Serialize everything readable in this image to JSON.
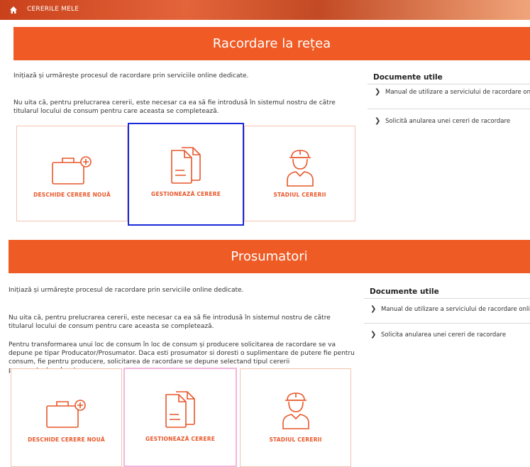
{
  "nav": {
    "breadcrumb": "CERERILE MELE"
  },
  "section1": {
    "title": "Racordare la rețea",
    "intro": "Inițiază și urmărește procesul de racordare prin serviciile online dedicate.",
    "note": "Nu uita că, pentru prelucrarea cererii, este necesar ca ea să fie introdusă în sistemul nostru de către titularul locului de consum pentru care aceasta se completează.",
    "docs_title": "Documente utile",
    "docs": [
      "Manual de utilizare a serviciului de racordare online",
      "Solicită anularea unei cereri de racordare"
    ],
    "cards": [
      "DESCHIDE CERERE NOUĂ",
      "GESTIONEAZĂ CERERE",
      "STADIUL CERERII"
    ]
  },
  "section2": {
    "title": "Prosumatori",
    "intro": "Inițiază și urmărește procesul de racordare prin serviciile online dedicate.",
    "note": "Nu uita că, pentru prelucrarea cererii, este necesar ca ea să fie introdusă în sistemul nostru de către titularul locului de consum pentru care aceasta se completează.",
    "extra": "Pentru transformarea unui loc de consum în loc de consum și producere solicitarea de racordare se va depune pe tipar Producator/Prosumator. Daca esti prosumator si doresti o suplimentare de putere fie pentru consum, fie pentru producere, solicitarea de racordare se depune selectand tipul cererii prosumator/producator.",
    "docs_title": "Documente utile",
    "docs": [
      "Manual de utilizare a serviciului de racordare online",
      "Solicita anularea unei cereri de racordare"
    ],
    "cards": [
      "DESCHIDE CERERE NOUĂ",
      "GESTIONEAZĂ CERERE",
      "STADIUL CERERII"
    ]
  },
  "colors": {
    "accent": "#f05a24",
    "icon": "#e8572a",
    "card_border": "#f3c3b1",
    "selected_blue": "#1a2ad8",
    "selected_pink": "#f2b5dc"
  }
}
